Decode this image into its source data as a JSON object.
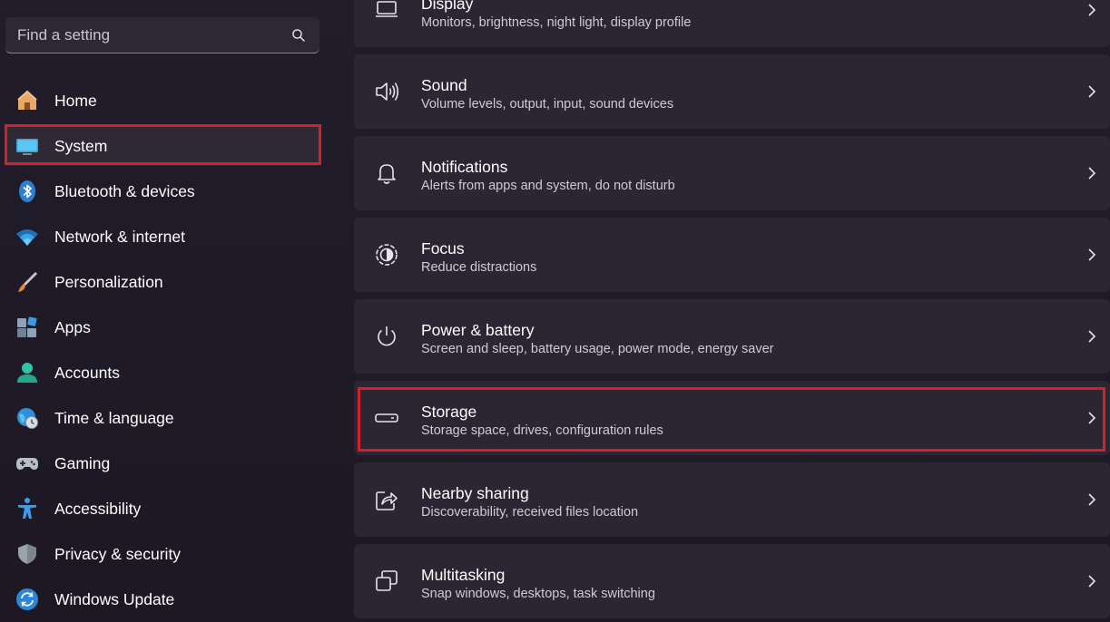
{
  "search": {
    "placeholder": "Find a setting",
    "icon": "search-icon"
  },
  "sidebar": {
    "items": [
      {
        "label": "Home",
        "icon": "home-icon"
      },
      {
        "label": "System",
        "icon": "monitor-icon",
        "selected": true
      },
      {
        "label": "Bluetooth & devices",
        "icon": "bluetooth-icon"
      },
      {
        "label": "Network & internet",
        "icon": "wifi-icon"
      },
      {
        "label": "Personalization",
        "icon": "paintbrush-icon"
      },
      {
        "label": "Apps",
        "icon": "apps-icon"
      },
      {
        "label": "Accounts",
        "icon": "person-icon"
      },
      {
        "label": "Time & language",
        "icon": "globe-clock-icon"
      },
      {
        "label": "Gaming",
        "icon": "gamepad-icon"
      },
      {
        "label": "Accessibility",
        "icon": "accessibility-icon"
      },
      {
        "label": "Privacy & security",
        "icon": "shield-icon"
      },
      {
        "label": "Windows Update",
        "icon": "sync-icon"
      }
    ]
  },
  "main": {
    "cards": [
      {
        "title": "Display",
        "subtitle": "Monitors, brightness, night light, display profile",
        "icon": "display-icon"
      },
      {
        "title": "Sound",
        "subtitle": "Volume levels, output, input, sound devices",
        "icon": "speaker-icon"
      },
      {
        "title": "Notifications",
        "subtitle": "Alerts from apps and system, do not disturb",
        "icon": "bell-icon"
      },
      {
        "title": "Focus",
        "subtitle": "Reduce distractions",
        "icon": "focus-icon"
      },
      {
        "title": "Power & battery",
        "subtitle": "Screen and sleep, battery usage, power mode, energy saver",
        "icon": "power-icon"
      },
      {
        "title": "Storage",
        "subtitle": "Storage space, drives, configuration rules",
        "icon": "storage-drive-icon",
        "highlighted": true
      },
      {
        "title": "Nearby sharing",
        "subtitle": "Discoverability, received files location",
        "icon": "share-icon"
      },
      {
        "title": "Multitasking",
        "subtitle": "Snap windows, desktops, task switching",
        "icon": "multitasking-icon"
      }
    ]
  },
  "colors": {
    "highlight": "#d3202f",
    "accent": "#4cc2ff",
    "card": "#2c2634"
  }
}
